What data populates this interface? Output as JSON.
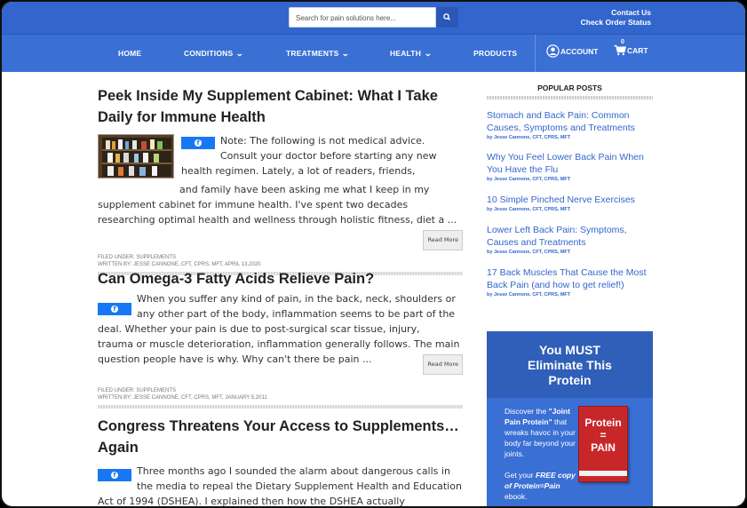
{
  "header": {
    "search_placeholder": "Search for pain solutions here...",
    "contact_link": "Contact Us",
    "order_link": "Check Order Status"
  },
  "nav": {
    "home": "HOME",
    "conditions": "CONDITIONS",
    "treatments": "TREATMENTS",
    "health": "HEALTH",
    "products": "PRODUCTS",
    "account": "ACCOUNT",
    "cart": "CART",
    "cart_count": "0"
  },
  "posts": [
    {
      "title_line1": "Peek Inside My Supplement Cabinet: What I Take",
      "title_line2": "Daily for Immune Health",
      "body_line1": "Note: The following is not medical advice.",
      "body_line2": "Consult your doctor before starting any new",
      "body_line3": "health regimen. Lately, a lot of readers, friends,",
      "body_line4": "and family have been asking me what I keep in my",
      "body_line5": "supplement cabinet for immune health. I've spent two decades",
      "body_line6": "researching optimal health and wellness through holistic fitness, diet a ...",
      "read_more": "Read More",
      "filed": "FILED UNDER: SUPPLEMENTS",
      "written": "WRITTEN BY: JESSE CANNONE, CFT, CPRS, MFT, APRIL 13,2020"
    },
    {
      "title_line1": "Can Omega-3 Fatty Acids Relieve Pain?",
      "body_line1": "When you suffer any kind of pain, in the back, neck, shoulders or",
      "body_line2": "any other part of the body, inflammation seems to be part of the",
      "body_line3": "deal. Whether your pain is due to post-surgical scar tissue, injury,",
      "body_line4": "trauma or muscle deterioration, inflammation generally follows. The main",
      "body_line5": "question people have is why. Why can't there be pain ...",
      "read_more": "Read More",
      "filed": "FILED UNDER: SUPPLEMENTS",
      "written": "WRITTEN BY: JESSE CANNONE, CFT, CPRS, MFT, JANUARY 5,2011"
    },
    {
      "title_line1": "Congress Threatens Your Access to Supplements…",
      "title_line2": "Again",
      "body_line1": "Three months ago I sounded the alarm about dangerous calls in",
      "body_line2": "the media to repeal the Dietary Supplement Health and Education",
      "body_line3": "Act of 1994 (DSHEA). I explained then how the DSHEA actually"
    }
  ],
  "sidebar": {
    "heading": "POPULAR POSTS",
    "items": [
      {
        "line1": "Stomach and Back Pain: Common",
        "line2": "Causes, Symptoms and Treatments",
        "by": "by Jesse Cannone, CFT, CPRS, MFT"
      },
      {
        "line1": "Why You Feel Lower Back Pain When",
        "line2": "You Have the Flu",
        "by": "by Jesse Cannone, CFT, CPRS, MFT"
      },
      {
        "line1": "10 Simple Pinched Nerve Exercises",
        "line2": "",
        "by": "by Jesse Cannone, CFT, CPRS, MFT"
      },
      {
        "line1": "Lower Left Back Pain: Symptoms,",
        "line2": "Causes and Treatments",
        "by": "by Jesse Cannone, CFT, CPRS, MFT"
      },
      {
        "line1": "17 Back Muscles That Cause the Most",
        "line2": "Back Pain (and how to get relief!)",
        "by": "by Jesse Cannone, CFT, CPRS, MFT"
      }
    ]
  },
  "promo": {
    "head_line1": "You MUST",
    "head_line2": "Eliminate This",
    "head_line3": "Protein",
    "body_pre": "Discover the ",
    "body_bold": "\"Joint Pain Protein\"",
    "body_post": " that wreaks havoc in your body far beyond your joints.",
    "cta_pre": "Get your ",
    "cta_bold": "FREE copy of Protein=Pain",
    "cta_post": " ebook.",
    "book_title_1": "Protein",
    "book_title_2": "=",
    "book_title_3": "PAIN"
  },
  "colors": {
    "topbar": "#3366cc",
    "navbar": "#3a6fd4",
    "link": "#3366cc",
    "facebook": "#1877f2"
  }
}
